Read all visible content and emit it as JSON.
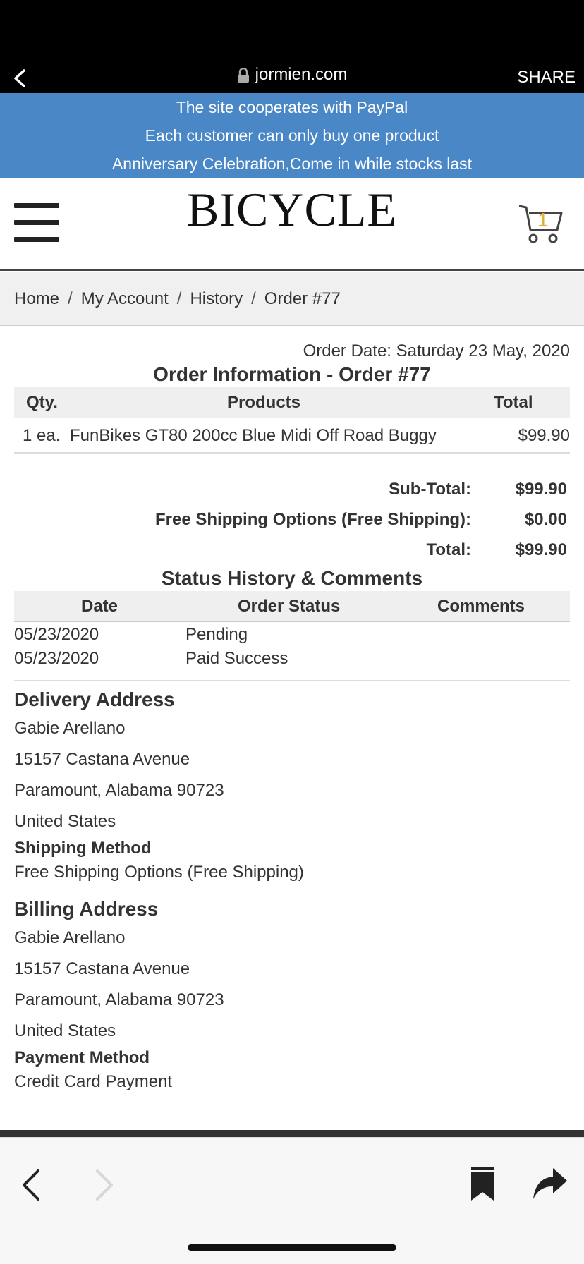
{
  "browser": {
    "url": "jormien.com",
    "share_label": "SHARE"
  },
  "banner": {
    "lines": [
      "The site cooperates with PayPal",
      "Each customer can only buy one product",
      "Anniversary Celebration,Come in while stocks last"
    ]
  },
  "header": {
    "logo": "BICYCLE",
    "cart_count": "1"
  },
  "breadcrumb": [
    "Home",
    "My Account",
    "History",
    "Order #77"
  ],
  "order": {
    "date": "Order Date: Saturday 23 May, 2020",
    "title": "Order Information - Order #77",
    "columns": {
      "qty": "Qty.",
      "products": "Products",
      "total": "Total"
    },
    "items": [
      {
        "qty": "1 ea.",
        "product": "FunBikes GT80 200cc Blue Midi Off Road Buggy",
        "total": "$99.90"
      }
    ],
    "totals": [
      {
        "label": "Sub-Total:",
        "value": "$99.90"
      },
      {
        "label": "Free Shipping Options (Free Shipping):",
        "value": "$0.00"
      },
      {
        "label": "Total:",
        "value": "$99.90"
      }
    ]
  },
  "status": {
    "title": "Status History & Comments",
    "columns": {
      "date": "Date",
      "status": "Order Status",
      "comments": "Comments"
    },
    "rows": [
      {
        "date": "05/23/2020",
        "status": "Pending"
      },
      {
        "date": "05/23/2020",
        "status": "Paid Success"
      }
    ]
  },
  "delivery": {
    "title": "Delivery Address",
    "lines": [
      "Gabie Arellano",
      "15157 Castana Avenue",
      "Paramount, Alabama 90723",
      "United States"
    ],
    "method_label": "Shipping Method",
    "method": "Free Shipping Options (Free Shipping)"
  },
  "billing": {
    "title": "Billing Address",
    "lines": [
      "Gabie Arellano",
      "15157 Castana Avenue",
      "Paramount, Alabama 90723",
      "United States"
    ],
    "method_label": "Payment Method",
    "method": "Credit Card Payment"
  },
  "colors": {
    "banner": "#4a87c6",
    "cart_badge": "#e2b03a"
  }
}
